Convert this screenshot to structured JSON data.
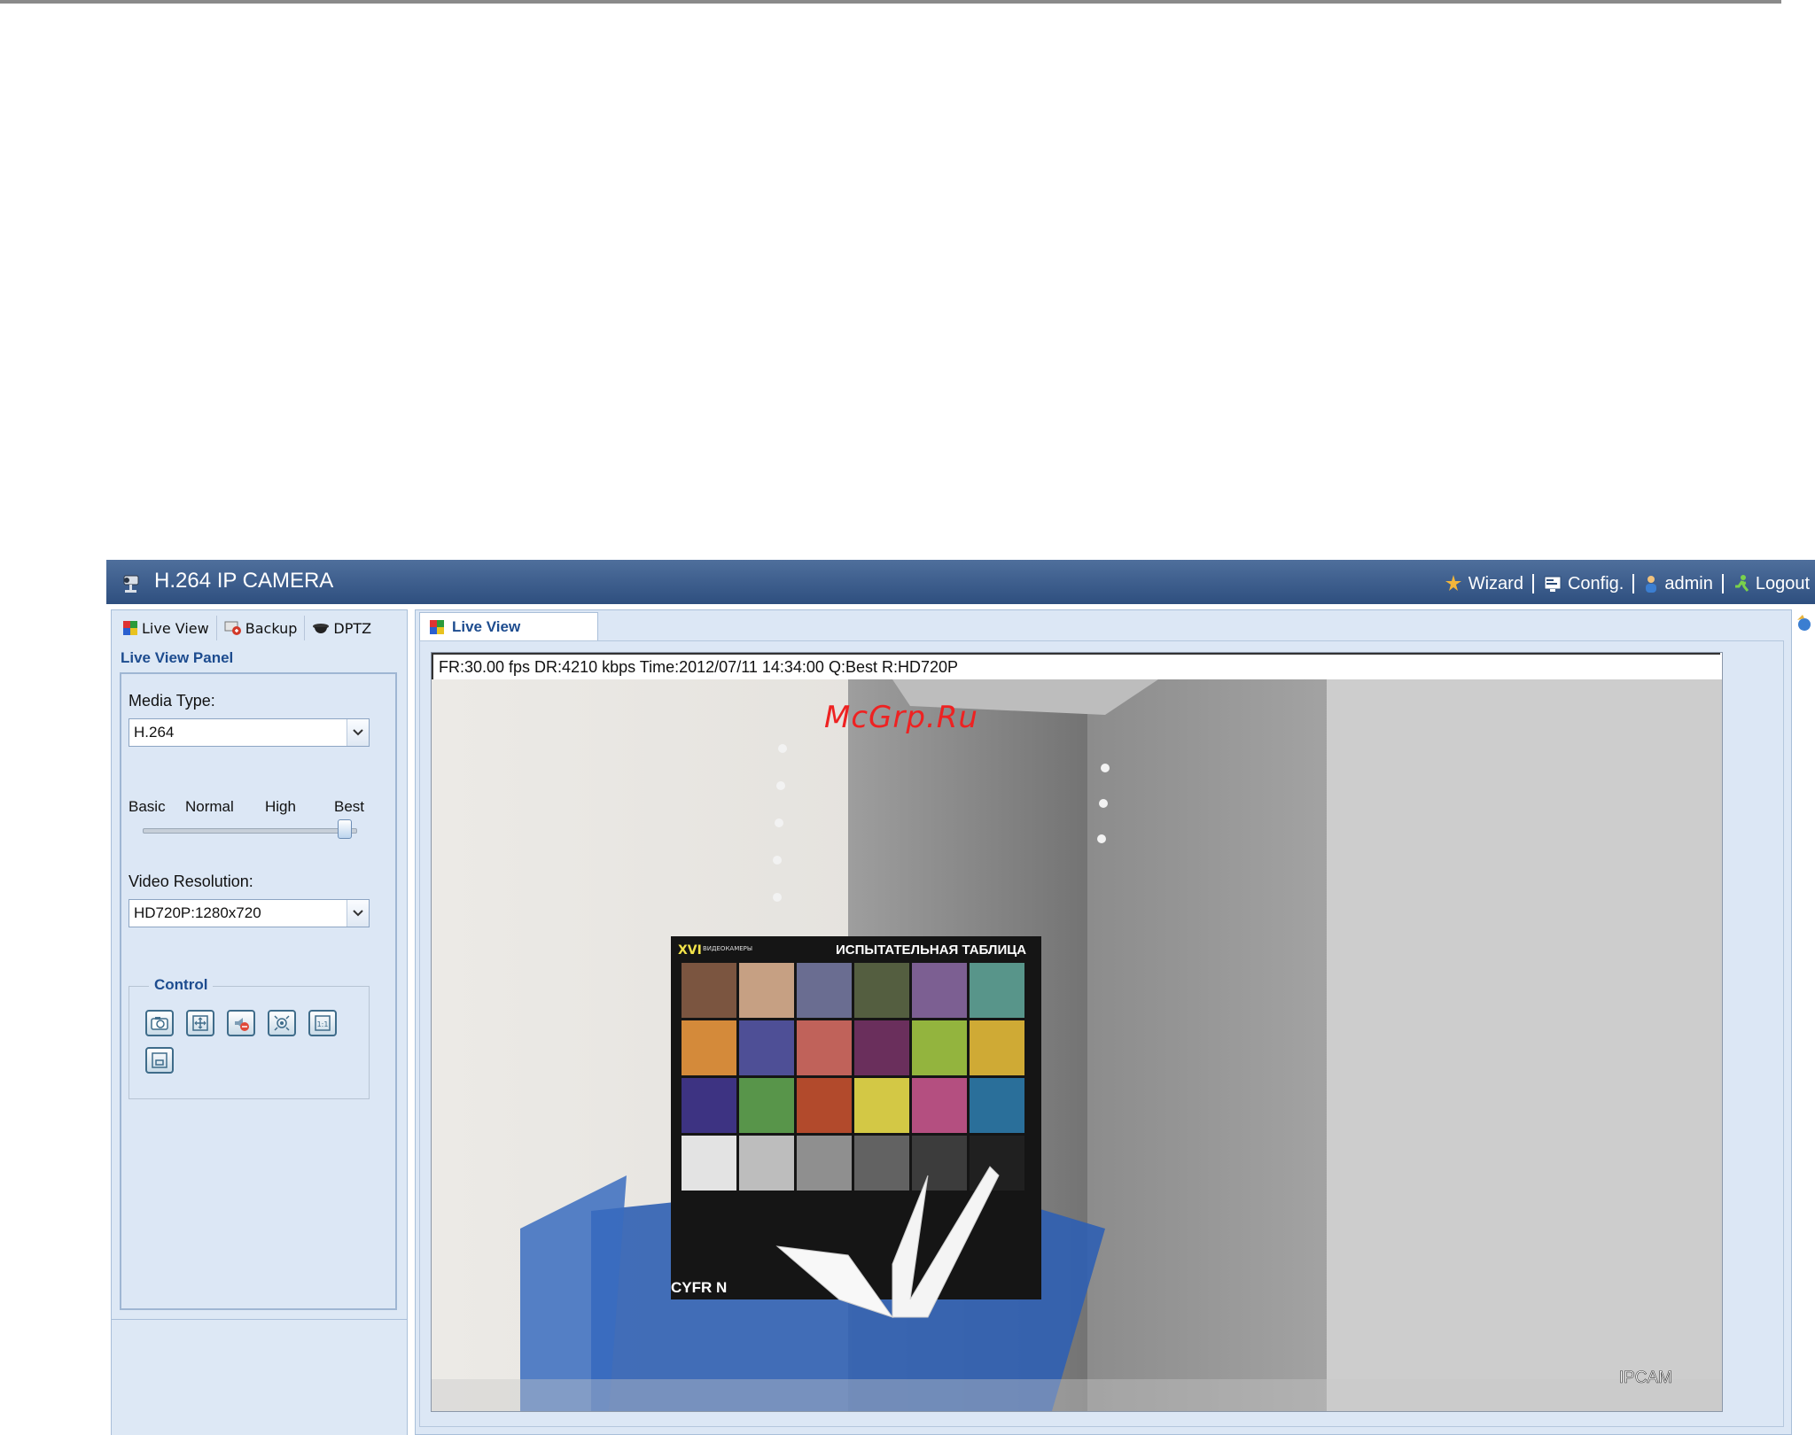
{
  "watermark": "McGrp.Ru",
  "app": {
    "title": "H.264 IP CAMERA",
    "nav": [
      {
        "label": "Wizard",
        "icon": "wizard-icon"
      },
      {
        "label": "Config.",
        "icon": "config-icon"
      },
      {
        "label": "admin",
        "icon": "user-icon"
      },
      {
        "label": "Logout",
        "icon": "logout-icon"
      }
    ]
  },
  "sidebar": {
    "tabs": [
      {
        "label": "Live View",
        "icon": "live-view-icon"
      },
      {
        "label": "Backup",
        "icon": "backup-icon"
      },
      {
        "label": "DPTZ",
        "icon": "dptz-icon"
      }
    ],
    "panel_title": "Live View Panel",
    "media_type": {
      "label": "Media Type:",
      "value": "H.264"
    },
    "quality": {
      "levels": [
        "Basic",
        "Normal",
        "High",
        "Best"
      ],
      "selected": "Best"
    },
    "video_resolution": {
      "label": "Video Resolution:",
      "value": "HD720P:1280x720"
    },
    "control": {
      "legend": "Control",
      "buttons": [
        "snapshot-icon",
        "fullscreen-icon",
        "audio-mute-icon",
        "zoom-icon",
        "actual-size-icon",
        "window-icon"
      ]
    }
  },
  "main": {
    "tab_label": "Live View",
    "status": "FR:30.00 fps  DR:4210 kbps Time:2012/07/11 14:34:00 Q:Best R:HD720P",
    "video": {
      "chart_header_small": "ВИДЕОКАМЕРЫ",
      "chart_logo": "XVI",
      "chart_title": "ИСПЫТАТЕЛЬНАЯ ТАБЛИЦА",
      "chart_brand": "CYFR  N",
      "overlay_label": "IPCAM",
      "color_patches": [
        "#7b5540",
        "#c6a083",
        "#6a6d91",
        "#545e40",
        "#7c5f92",
        "#58958a",
        "#d48a3a",
        "#4e4f96",
        "#c0625a",
        "#6a2f5c",
        "#93b43e",
        "#cfaa35",
        "#3d3382",
        "#58954a",
        "#b24a2c",
        "#d3c845",
        "#b44f80",
        "#2a6f9a",
        "#e3e3e3",
        "#bdbdbd",
        "#8f8f8f",
        "#626262",
        "#3c3c3c",
        "#202020"
      ]
    }
  }
}
